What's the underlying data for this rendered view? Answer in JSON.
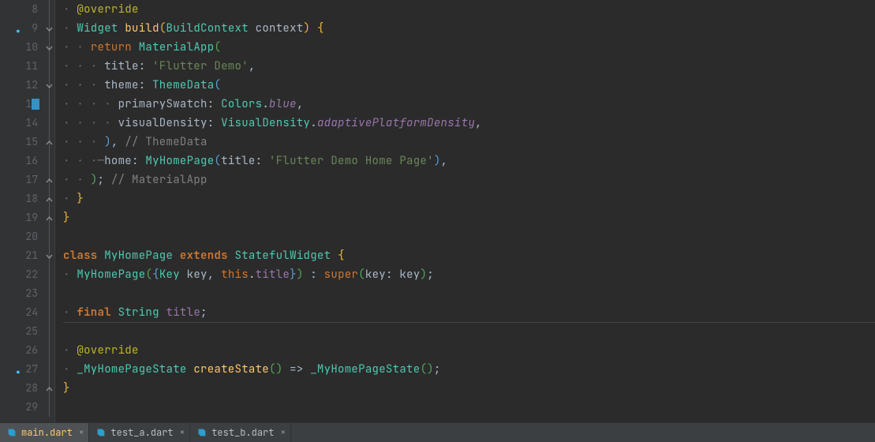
{
  "lines": {
    "start": 8,
    "end": 29
  },
  "code": {
    "l8": {
      "ann": "@override"
    },
    "l9": {
      "type": "Widget",
      "fn": "build",
      "p1": "(",
      "cls": "BuildContext",
      "param": "context",
      "p2": ")",
      "brace": "{"
    },
    "l10": {
      "kw": "return",
      "cls": "MaterialApp",
      "p": "("
    },
    "l11": {
      "key": "title",
      "colon": ":",
      "str": "'Flutter Demo'",
      "comma": ","
    },
    "l12": {
      "key": "theme",
      "colon": ":",
      "cls": "ThemeData",
      "p": "("
    },
    "l13": {
      "key": "primarySwatch",
      "colon": ":",
      "cls": "Colors",
      "dot": ".",
      "val": "blue",
      "comma": ","
    },
    "l14": {
      "key": "visualDensity",
      "colon": ":",
      "cls": "VisualDensity",
      "dot": ".",
      "val": "adaptivePlatformDensity",
      "comma": ","
    },
    "l15": {
      "close": ")",
      "comma": ",",
      "cmt": "// ThemeData"
    },
    "l16": {
      "key": "home",
      "colon": ":",
      "cls": "MyHomePage",
      "p1": "(",
      "arg": "title",
      "colon2": ":",
      "str": "'Flutter Demo Home Page'",
      "p2": ")",
      "comma": ","
    },
    "l17": {
      "close": ")",
      "semi": ";",
      "cmt": "// MaterialApp"
    },
    "l18": {
      "brace": "}"
    },
    "l19": {
      "brace": "}"
    },
    "l21": {
      "kw": "class",
      "name": "MyHomePage",
      "ext": "extends",
      "sup": "StatefulWidget",
      "brace": "{"
    },
    "l22": {
      "name": "MyHomePage",
      "p1": "(",
      "b1": "{",
      "type": "Key",
      "param1": "key",
      "comma1": ",",
      "kw": "this",
      "dot": ".",
      "field": "title",
      "b2": "}",
      "p2": ")",
      "colon": ":",
      "sup": "super",
      "p3": "(",
      "arg": "key",
      "colon2": ":",
      "val": "key",
      "p4": ")",
      "semi": ";"
    },
    "l24": {
      "kw": "final",
      "type": "String",
      "name": "title",
      "semi": ";"
    },
    "l26": {
      "ann": "@override"
    },
    "l27": {
      "type": "_MyHomePageState",
      "fn": "createState",
      "p1": "(",
      "p2": ")",
      "arrow": "=>",
      "cls": "_MyHomePageState",
      "p3": "(",
      "p4": ")",
      "semi": ";"
    },
    "l28": {
      "brace": "}"
    }
  },
  "tabs": [
    {
      "label": "main.dart",
      "active": true
    },
    {
      "label": "test_a.dart",
      "active": false
    },
    {
      "label": "test_b.dart",
      "active": false
    }
  ]
}
